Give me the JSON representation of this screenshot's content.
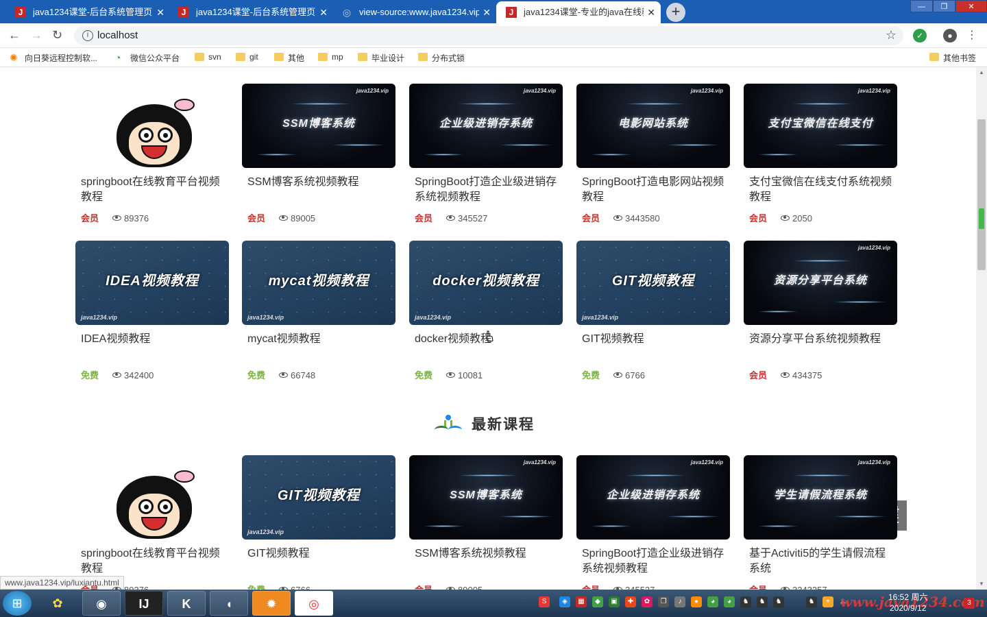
{
  "browser": {
    "tabs": [
      {
        "title": "java1234课堂-后台系统管理页面",
        "icon": "J",
        "active": false
      },
      {
        "title": "java1234课堂-后台系统管理页面",
        "icon": "J",
        "active": false
      },
      {
        "title": "view-source:www.java1234.vip",
        "icon": "globe",
        "active": false
      },
      {
        "title": "java1234课堂-专业的java在线教",
        "icon": "J",
        "active": true
      }
    ],
    "url": "localhost",
    "bookmarks": [
      "向日葵远程控制软...",
      "微信公众平台",
      "svn",
      "git",
      "其他",
      "mp",
      "毕业设计",
      "分布式锁"
    ],
    "other_bookmarks": "其他书签",
    "status_url": "www.java1234.vip/luxiantu.html"
  },
  "tags": {
    "vip": "会员",
    "free": "免费"
  },
  "hot_courses": [
    {
      "title": "springboot在线教育平台视频教程",
      "tag": "vip",
      "views": "89376",
      "thumb": "avatar",
      "thumb_text": ""
    },
    {
      "title": "SSM博客系统视频教程",
      "tag": "vip",
      "views": "89005",
      "thumb": "dark",
      "thumb_text": "SSM博客系统"
    },
    {
      "title": "SpringBoot打造企业级进销存系统视频教程",
      "tag": "vip",
      "views": "345527",
      "thumb": "dark",
      "thumb_text": "企业级进销存系统"
    },
    {
      "title": "SpringBoot打造电影网站视频教程",
      "tag": "vip",
      "views": "3443580",
      "thumb": "dark",
      "thumb_text": "电影网站系统"
    },
    {
      "title": "支付宝微信在线支付系统视频教程",
      "tag": "vip",
      "views": "2050",
      "thumb": "dark",
      "thumb_text": "支付宝微信在线支付"
    },
    {
      "title": "IDEA视频教程",
      "tag": "free",
      "views": "342400",
      "thumb": "blue",
      "thumb_text": "IDEA视频教程"
    },
    {
      "title": "mycat视频教程",
      "tag": "free",
      "views": "66748",
      "thumb": "blue",
      "thumb_text": "mycat视频教程"
    },
    {
      "title": "docker视频教程",
      "tag": "free",
      "views": "10081",
      "thumb": "blue",
      "thumb_text": "docker视频教程"
    },
    {
      "title": "GIT视频教程",
      "tag": "free",
      "views": "6766",
      "thumb": "blue",
      "thumb_text": "GIT视频教程"
    },
    {
      "title": "资源分享平台系统视频教程",
      "tag": "vip",
      "views": "434375",
      "thumb": "dark",
      "thumb_text": "资源分享平台系统"
    }
  ],
  "section_title": "最新课程",
  "new_courses": [
    {
      "title": "springboot在线教育平台视频教程",
      "tag": "vip",
      "views": "89376",
      "thumb": "avatar",
      "thumb_text": ""
    },
    {
      "title": "GIT视频教程",
      "tag": "free",
      "views": "6766",
      "thumb": "blue",
      "thumb_text": "GIT视频教程"
    },
    {
      "title": "SSM博客系统视频教程",
      "tag": "vip",
      "views": "89005",
      "thumb": "dark",
      "thumb_text": "SSM博客系统"
    },
    {
      "title": "SpringBoot打造企业级进销存系统视频教程",
      "tag": "vip",
      "views": "345527",
      "thumb": "dark",
      "thumb_text": "企业级进销存系统"
    },
    {
      "title": "基于Activiti5的学生请假流程系统",
      "tag": "vip",
      "views": "3243257",
      "thumb": "dark",
      "thumb_text": "学生请假流程系统"
    }
  ],
  "thumb_brand": "java1234.vip",
  "overlay_key": "左键",
  "taskbar": {
    "time": "16:52 周六",
    "date": "2020/9/12",
    "watermark": "www.java1234.com",
    "apps": [
      "IntelliJ",
      "Kdenlive",
      "Dolphin",
      "Aurora",
      "Chrome"
    ]
  },
  "colors": {
    "tabstrip": "#1a5fb4",
    "vip": "#c9302c",
    "free": "#7cb342"
  }
}
